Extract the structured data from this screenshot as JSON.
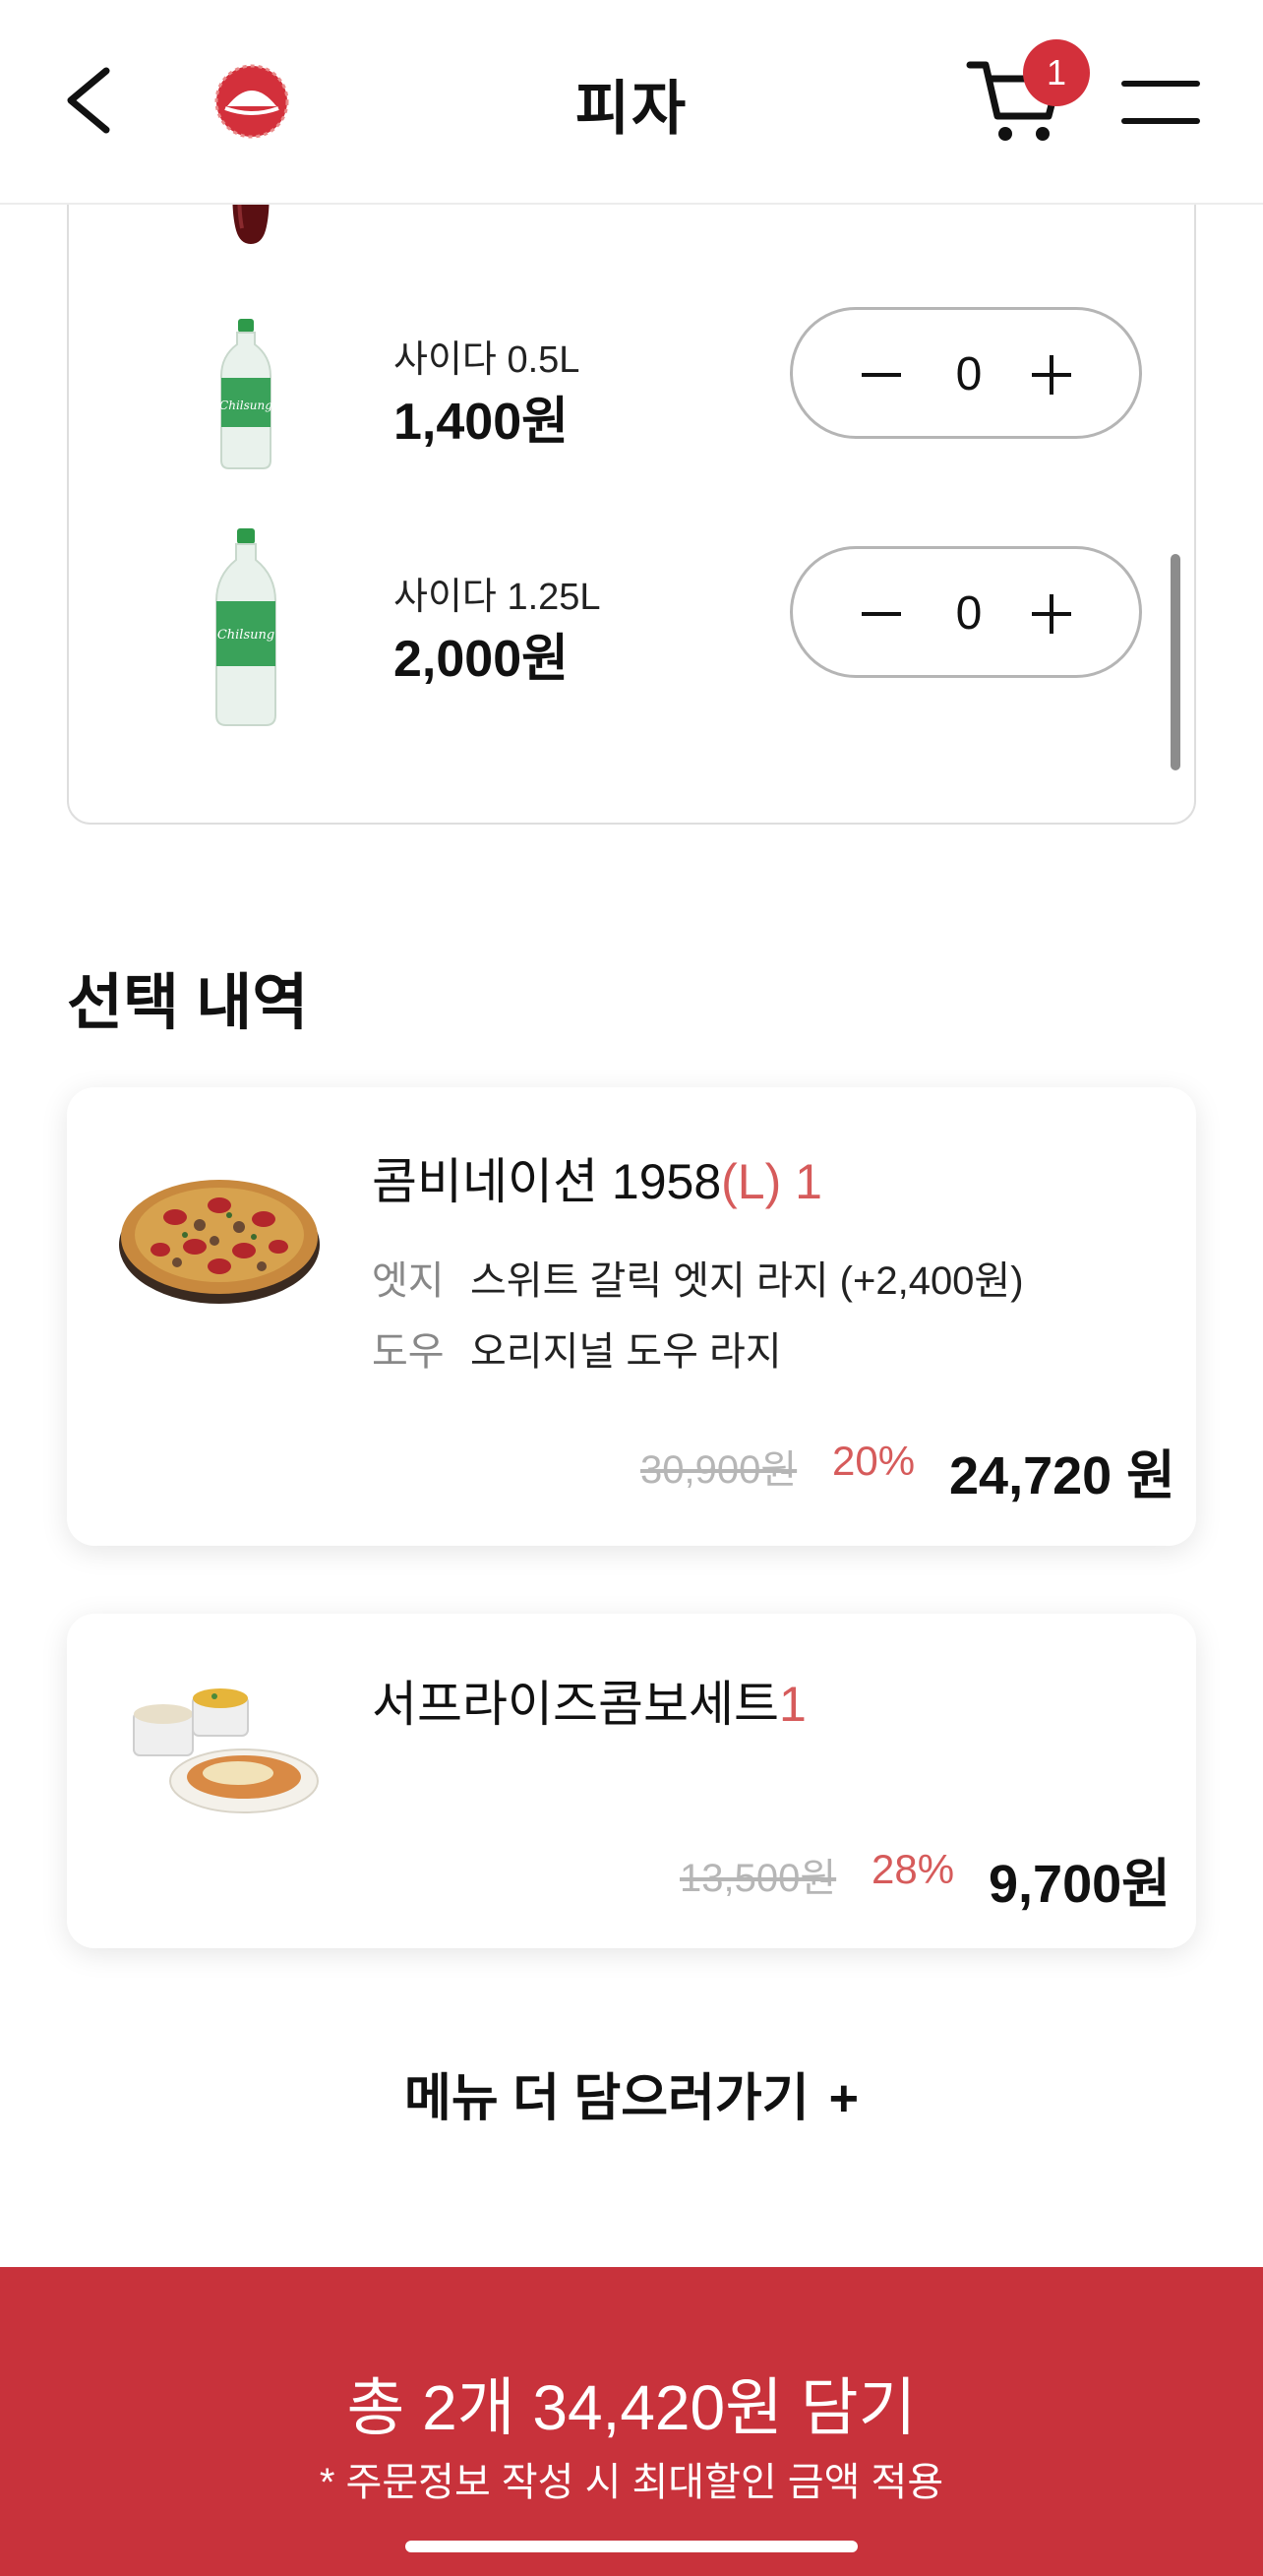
{
  "header": {
    "title": "피자",
    "cart_count": "1"
  },
  "drinks": [
    {
      "name": "사이다 0.5L",
      "price": "1,400원",
      "qty": "0"
    },
    {
      "name": "사이다 1.25L",
      "price": "2,000원",
      "qty": "0"
    }
  ],
  "selection": {
    "title": "선택 내역",
    "items": [
      {
        "name": "콤비네이션 1958",
        "size": "(L)",
        "qty": "1",
        "options": [
          {
            "label": "엣지",
            "value": "스위트 갈릭 엣지 라지 (+2,400원)"
          },
          {
            "label": "도우",
            "value": "오리지널 도우 라지"
          }
        ],
        "original_price": "30,900원",
        "discount": "20%",
        "final_price": "24,720 원"
      },
      {
        "name": "서프라이즈콤보세트",
        "qty": "1",
        "original_price": "13,500원",
        "discount": "28%",
        "final_price": "9,700원"
      }
    ]
  },
  "more_menu": {
    "label": "메뉴 더 담으러가기",
    "plus": "+"
  },
  "cta": {
    "label": "총 2개 34,420원 담기",
    "note": "* 주문정보 작성 시 최대할인 금액 적용"
  },
  "colors": {
    "accent": "#c8323b",
    "discount": "#d65b5b",
    "badge": "#d3303b"
  },
  "icons": [
    "back-arrow-icon",
    "pizza-hut-logo-icon",
    "cart-icon",
    "hamburger-menu-icon"
  ]
}
